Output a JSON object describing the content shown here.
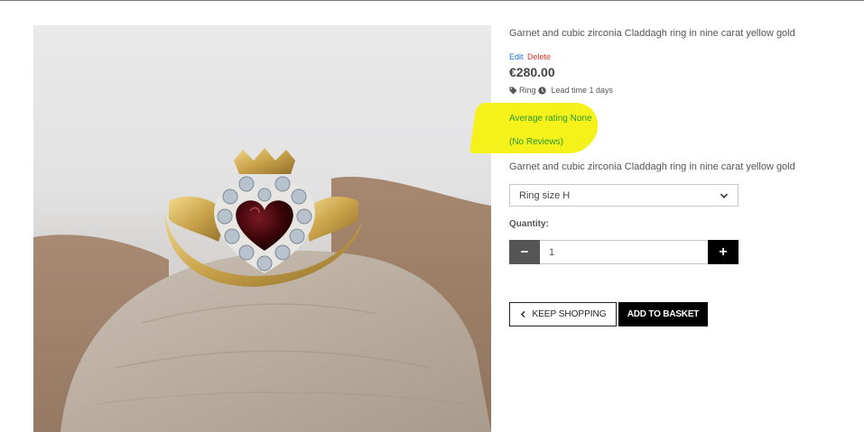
{
  "product": {
    "title": "Garnet and cubic zirconia Claddagh ring in nine carat yellow gold",
    "description_title": "Garnet and cubic zirconia Claddagh ring in nine carat yellow gold",
    "price": "€280.00",
    "category": "Ring",
    "lead_time": "Lead time 1 days",
    "image_alt": "Garnet Claddagh ring on driftwood"
  },
  "admin": {
    "edit_label": "Edit",
    "delete_label": "Delete"
  },
  "rating": {
    "average_text": "Average rating None",
    "reviews_text": "(No Reviews)"
  },
  "options": {
    "size_selected": "Ring size H"
  },
  "quantity": {
    "label": "Quantity:",
    "value": "1",
    "minus_symbol": "−",
    "plus_symbol": "+"
  },
  "actions": {
    "keep_shopping_label": "KEEP SHOPPING",
    "add_to_basket_label": "ADD TO BASKET"
  },
  "icons": {
    "tag": "tag-icon",
    "clock": "clock-icon",
    "select": "chevron-down-icon",
    "back": "chevron-left-icon"
  },
  "colors": {
    "edit_link": "#1e6fd0",
    "delete_link": "#e0322f",
    "rating_text": "#2e9a2e",
    "highlight": "#f4f21a",
    "minus_button": "#555555",
    "plus_button": "#000000"
  }
}
